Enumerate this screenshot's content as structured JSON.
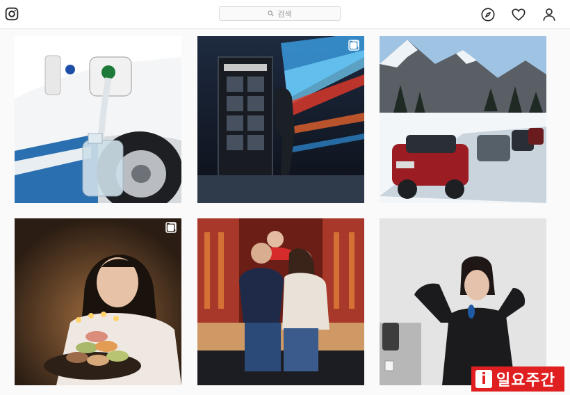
{
  "header": {
    "logo_icon": "instagram-logo-icon",
    "search": {
      "placeholder": "검색",
      "icon": "search-icon"
    },
    "nav_icons": [
      "compass-icon",
      "heart-icon",
      "profile-icon"
    ]
  },
  "posts": [
    {
      "subject": "car-fueling-with-water-bottle",
      "multi": false
    },
    {
      "subject": "phone-booth-light-trails",
      "multi": true
    },
    {
      "subject": "red-jeep-in-snow",
      "multi": false
    },
    {
      "subject": "birthday-cake-macarons",
      "multi": true
    },
    {
      "subject": "family-portrait",
      "multi": false
    },
    {
      "subject": "woman-posing",
      "multi": false
    }
  ],
  "watermark": {
    "icon_letter": "i",
    "text": "일요주간",
    "color": "#e02020"
  },
  "colors": {
    "border": "#dbdbdb",
    "background": "#fafafa",
    "icon": "#262626"
  }
}
